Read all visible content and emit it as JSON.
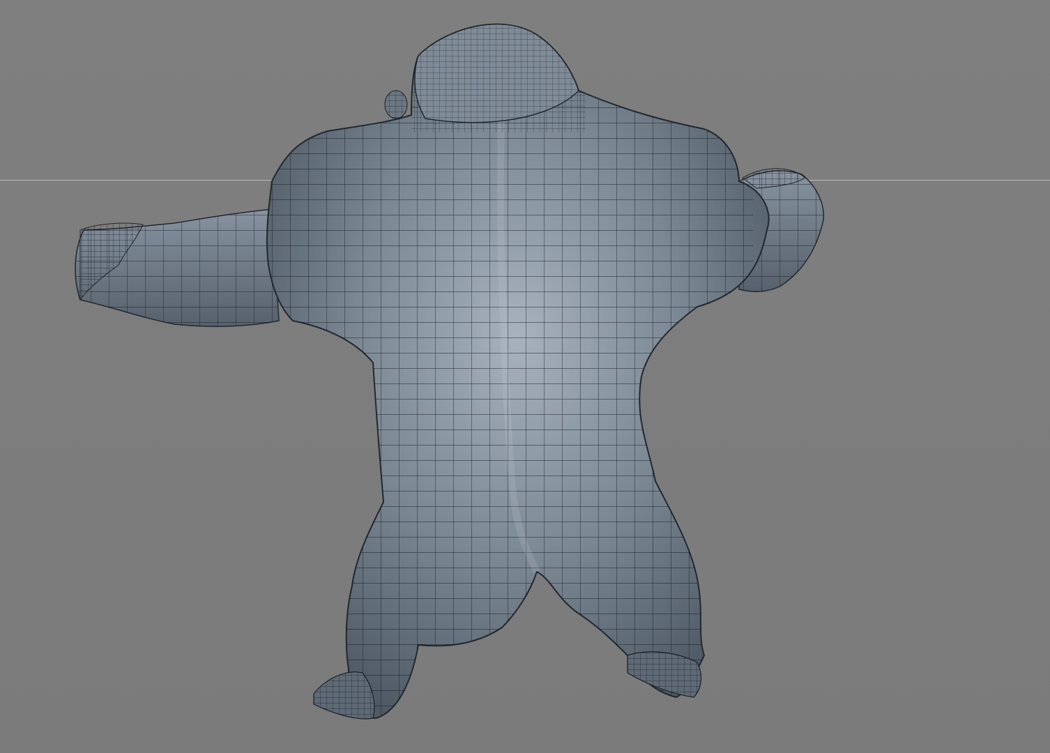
{
  "viewport": {
    "background_color": "#7d7d7d",
    "horizon_line_color": "#b9b9b9",
    "model_fill_color": "#5e6a76",
    "model_highlight_color": "#9aa6b2",
    "wireframe_color": "#111418"
  },
  "scene": {
    "object": "gorilla-mesh",
    "shading": "smooth-with-wireframe",
    "view": "back"
  }
}
